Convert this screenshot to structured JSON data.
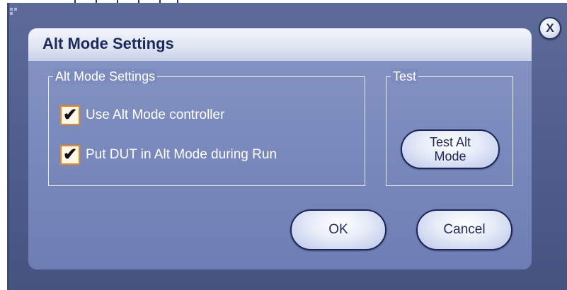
{
  "window": {
    "close_label": "X"
  },
  "dialog": {
    "title": "Alt Mode Settings",
    "settings_group": {
      "legend": "Alt Mode Settings",
      "options": [
        {
          "label": "Use Alt Mode controller",
          "checked": true,
          "check_glyph": "✔"
        },
        {
          "label": "Put DUT in Alt Mode during Run",
          "checked": true,
          "check_glyph": "✔"
        }
      ]
    },
    "test_group": {
      "legend": "Test",
      "button_label": "Test Alt Mode"
    },
    "buttons": {
      "ok_label": "OK",
      "cancel_label": "Cancel"
    }
  },
  "colors": {
    "background": "#5d6b99",
    "header": "#dfe4f2",
    "title_text": "#1b2a5e",
    "checkbox_border": "#e58c1e"
  }
}
